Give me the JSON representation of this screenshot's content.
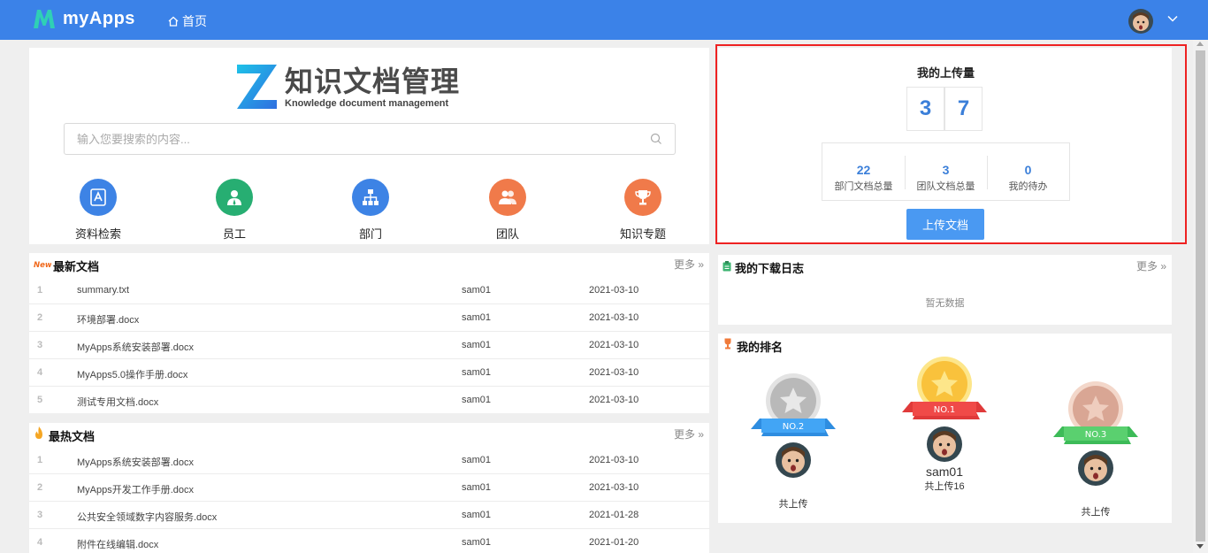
{
  "header": {
    "brand": "myApps",
    "home_label": "首页"
  },
  "search": {
    "logo_title": "知识文档管理",
    "logo_subtitle": "Knowledge document management",
    "placeholder": "输入您要搜索的内容..."
  },
  "quick_links": [
    {
      "label": "资料检索",
      "color": "#3d83e5",
      "icon": "search-file-icon"
    },
    {
      "label": "员工",
      "color": "#27ae72",
      "icon": "employee-icon"
    },
    {
      "label": "部门",
      "color": "#3d83e5",
      "icon": "org-chart-icon"
    },
    {
      "label": "团队",
      "color": "#f07a4a",
      "icon": "team-icon"
    },
    {
      "label": "知识专题",
      "color": "#f07a4a",
      "icon": "trophy-icon"
    }
  ],
  "upload": {
    "title": "我的上传量",
    "digits": [
      "3",
      "7"
    ],
    "stats": [
      {
        "value": "22",
        "label": "部门文档总量"
      },
      {
        "value": "3",
        "label": "团队文档总量"
      },
      {
        "value": "0",
        "label": "我的待办"
      }
    ],
    "button": "上传文档"
  },
  "latest": {
    "badge": "New",
    "title": "最新文档",
    "more": "更多",
    "rows": [
      {
        "idx": "1",
        "name": "summary.txt",
        "author": "sam01",
        "date": "2021-03-10"
      },
      {
        "idx": "2",
        "name": "环境部署.docx",
        "author": "sam01",
        "date": "2021-03-10"
      },
      {
        "idx": "3",
        "name": "MyApps系统安装部署.docx",
        "author": "sam01",
        "date": "2021-03-10"
      },
      {
        "idx": "4",
        "name": "MyApps5.0操作手册.docx",
        "author": "sam01",
        "date": "2021-03-10"
      },
      {
        "idx": "5",
        "name": "测试专用文档.docx",
        "author": "sam01",
        "date": "2021-03-10"
      }
    ]
  },
  "hot": {
    "title": "最热文档",
    "more": "更多",
    "rows": [
      {
        "idx": "1",
        "name": "MyApps系统安装部署.docx",
        "author": "sam01",
        "date": "2021-03-10"
      },
      {
        "idx": "2",
        "name": "MyApps开发工作手册.docx",
        "author": "sam01",
        "date": "2021-03-10"
      },
      {
        "idx": "3",
        "name": "公共安全领域数字内容服务.docx",
        "author": "sam01",
        "date": "2021-01-28"
      },
      {
        "idx": "4",
        "name": "附件在线编辑.docx",
        "author": "sam01",
        "date": "2021-01-20"
      }
    ]
  },
  "downloads": {
    "title": "我的下载日志",
    "more": "更多",
    "empty": "暂无数据"
  },
  "ranking": {
    "title": "我的排名",
    "first": {
      "badge": "NO.1",
      "name": "sam01",
      "count": "共上传16"
    },
    "second": {
      "badge": "NO.2",
      "count": "共上传"
    },
    "third": {
      "badge": "NO.3",
      "count": "共上传"
    }
  }
}
